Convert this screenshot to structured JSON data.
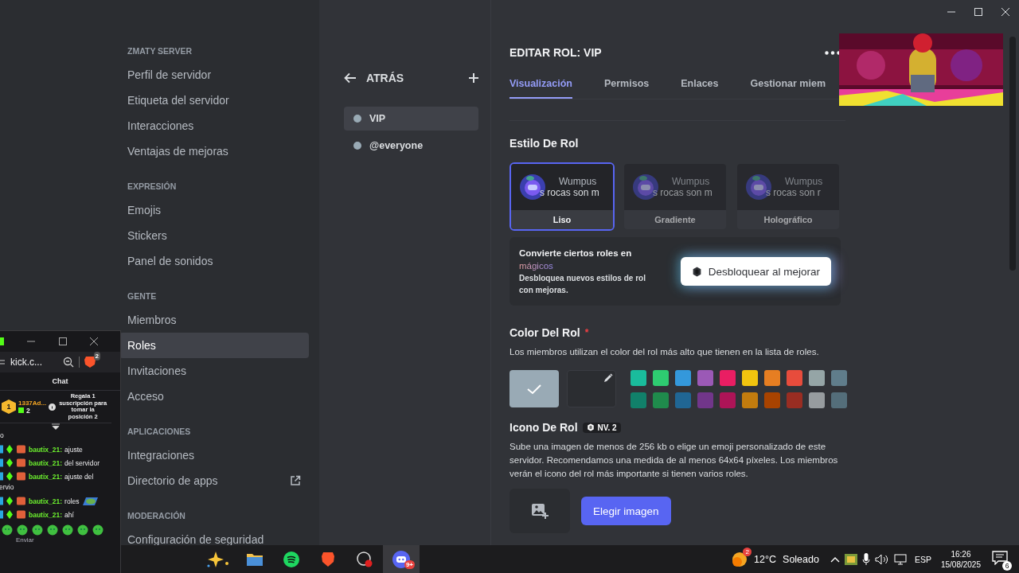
{
  "sidebar": {
    "sections": [
      {
        "header": "ZMATY SERVER",
        "items": [
          {
            "label": "Perfil de servidor",
            "selected": false,
            "external": false
          },
          {
            "label": "Etiqueta del servidor",
            "selected": false,
            "external": false
          },
          {
            "label": "Interacciones",
            "selected": false,
            "external": false
          },
          {
            "label": "Ventajas de mejoras",
            "selected": false,
            "external": false
          }
        ]
      },
      {
        "header": "EXPRESIÓN",
        "items": [
          {
            "label": "Emojis",
            "selected": false,
            "external": false
          },
          {
            "label": "Stickers",
            "selected": false,
            "external": false
          },
          {
            "label": "Panel de sonidos",
            "selected": false,
            "external": false
          }
        ]
      },
      {
        "header": "GENTE",
        "items": [
          {
            "label": "Miembros",
            "selected": false,
            "external": false
          },
          {
            "label": "Roles",
            "selected": true,
            "external": false
          },
          {
            "label": "Invitaciones",
            "selected": false,
            "external": false
          },
          {
            "label": "Acceso",
            "selected": false,
            "external": false
          }
        ]
      },
      {
        "header": "APLICACIONES",
        "items": [
          {
            "label": "Integraciones",
            "selected": false,
            "external": false
          },
          {
            "label": "Directorio de apps",
            "selected": false,
            "external": true
          }
        ]
      },
      {
        "header": "MODERACIÓN",
        "items": [
          {
            "label": "Configuración de seguridad",
            "selected": false,
            "external": false
          }
        ]
      }
    ]
  },
  "role_list": {
    "back_label": "ATRÁS",
    "roles": [
      {
        "name": "VIP",
        "selected": true
      },
      {
        "name": "@everyone",
        "selected": false
      }
    ]
  },
  "editor": {
    "title": "EDITAR ROL: VIP",
    "tabs": [
      {
        "label": "Visualización",
        "selected": true
      },
      {
        "label": "Permisos",
        "selected": false
      },
      {
        "label": "Enlaces",
        "selected": false
      },
      {
        "label": "Gestionar miem",
        "selected": false
      }
    ],
    "style_section": {
      "heading": "Estilo De Rol",
      "cards": [
        {
          "label": "Liso",
          "name": "Wumpus",
          "preview": "s rocas son m",
          "selected": true,
          "locked": false
        },
        {
          "label": "Gradiente",
          "name": "Wumpus",
          "preview": "s rocas son m",
          "selected": false,
          "locked": true
        },
        {
          "label": "Holográfico",
          "name": "Wumpus",
          "preview": "s rocas son r",
          "selected": false,
          "locked": true
        }
      ]
    },
    "upsell": {
      "title": "Convierte ciertos roles en",
      "highlight": "mágicos",
      "text": "Desbloquea nuevos estilos de rol con mejoras.",
      "button": "Desbloquear al mejorar"
    },
    "color_section": {
      "heading": "Color Del Rol",
      "required_mark": "*",
      "description": "Los miembros utilizan el color del rol más alto que tienen en la lista de roles.",
      "default_swatch": {
        "color": "#99aab5",
        "selected": true
      },
      "custom_swatch": {
        "selected": false
      },
      "swatches": [
        {
          "color": "#1abc9c",
          "selected": false
        },
        {
          "color": "#2ecc71",
          "selected": false
        },
        {
          "color": "#3498db",
          "selected": false
        },
        {
          "color": "#9b59b6",
          "selected": false
        },
        {
          "color": "#e91e63",
          "selected": false
        },
        {
          "color": "#f1c40f",
          "selected": false
        },
        {
          "color": "#e67e22",
          "selected": false
        },
        {
          "color": "#e74c3c",
          "selected": false
        },
        {
          "color": "#95a5a6",
          "selected": false
        },
        {
          "color": "#607d8b",
          "selected": false
        },
        {
          "color": "#11806a",
          "selected": false
        },
        {
          "color": "#1f8b4c",
          "selected": false
        },
        {
          "color": "#206694",
          "selected": false
        },
        {
          "color": "#71368a",
          "selected": false
        },
        {
          "color": "#ad1457",
          "selected": false
        },
        {
          "color": "#c27c0e",
          "selected": false
        },
        {
          "color": "#a84300",
          "selected": false
        },
        {
          "color": "#992d22",
          "selected": false
        },
        {
          "color": "#979c9f",
          "selected": false
        },
        {
          "color": "#546e7a",
          "selected": false
        }
      ]
    },
    "icon_section": {
      "heading": "Icono De Rol",
      "badge": "NV. 2",
      "description": "Sube una imagen de menos de 256 kb o elige un emoji personalizado de este servidor. Recomendamos una medida de al menos 64x64 píxeles. Los miembros verán el icono del rol más importante si tienen varios roles.",
      "button": "Elegir imagen"
    }
  },
  "chat_window": {
    "address": "kick.c...",
    "brave_badge": "2",
    "chat_title": "Chat",
    "leader": {
      "rank": "1",
      "name": "1337Ad...",
      "count": "2"
    },
    "gift_text": "Regala 1 suscripción para tomar la posición 2",
    "partial_line": "o",
    "messages": [
      {
        "user": "bautix_21:",
        "text": "ajuste",
        "emote": false
      },
      {
        "user": "bautix_21:",
        "text": "del servidor",
        "emote": false
      },
      {
        "user": "bautix_21:",
        "text": "ajuste del",
        "continuation": "ervio",
        "emote": false
      },
      {
        "user": "bautix_21:",
        "text": "roles",
        "emote": true
      },
      {
        "user": "bautix_21:",
        "text": "ahí",
        "emote": false
      }
    ],
    "send_label": "Enviar"
  },
  "taskbar": {
    "apps": [
      {
        "kind": "sparkle",
        "active": false
      },
      {
        "kind": "folder",
        "active": false
      },
      {
        "kind": "spotify",
        "active": false
      },
      {
        "kind": "brave",
        "active": false
      },
      {
        "kind": "obs",
        "active": false
      },
      {
        "kind": "discord",
        "active": true,
        "badge": "9+"
      }
    ],
    "weather": {
      "badge": "2",
      "temperature": "12°C",
      "condition": "Soleado"
    },
    "language": "ESP",
    "time": "16:26",
    "date": "15/08/2025",
    "notifications": "6"
  }
}
